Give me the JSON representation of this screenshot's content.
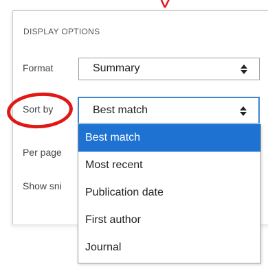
{
  "display_options": {
    "title": "DISPLAY OPTIONS",
    "format": {
      "label": "Format",
      "value": "Summary"
    },
    "sort_by": {
      "label": "Sort by",
      "value": "Best match",
      "options": [
        "Best match",
        "Most recent",
        "Publication date",
        "First author",
        "Journal"
      ],
      "selected_option": "Best match"
    },
    "per_page": {
      "label": "Per page"
    },
    "show_snippets": {
      "label": "Show sni"
    }
  },
  "annotation_colors": {
    "circle": "#e01818",
    "arrow": "#e01818"
  },
  "accent_color": "#1e73d2",
  "icons": {
    "select_arrows": "updown-chevrons-icon",
    "annotation_arrow": "red-arrow-icon",
    "annotation_circle": "red-circle-annotation"
  }
}
